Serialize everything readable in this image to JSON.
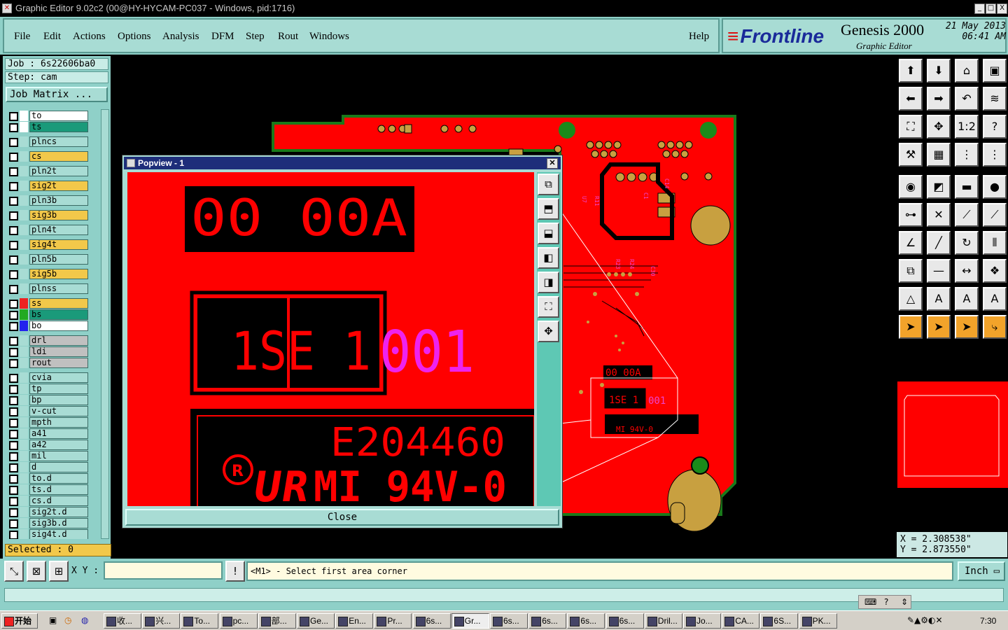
{
  "window": {
    "title": "Graphic Editor 9.02c2 (00@HY-HYCAM-PC037 - Windows, pid:1716)",
    "min": "_",
    "max": "□",
    "close": "X"
  },
  "menu": [
    "File",
    "Edit",
    "Actions",
    "Options",
    "Analysis",
    "DFM",
    "Step",
    "Rout",
    "Windows"
  ],
  "help": "Help",
  "brand": {
    "logo": "Frontline",
    "product": "Genesis 2000",
    "subtitle": "Graphic Editor",
    "date": "21 May 2013",
    "time": "06:41 AM"
  },
  "job": {
    "label": "Job : 6s22606ba0",
    "step": "Step: cam",
    "matrix_button": "Job Matrix ..."
  },
  "layers": [
    {
      "name": "to",
      "color": "#ffffff",
      "swatch": "#ffffff"
    },
    {
      "name": "ts",
      "color": "#1a9a7a",
      "swatch": "#ffffff"
    },
    {
      "name": "plncs",
      "color": "#a8dcd4",
      "swatch": "#a8dcd4"
    },
    {
      "name": "cs",
      "color": "#f2c84a",
      "swatch": "#a8dcd4"
    },
    {
      "name": "pln2t",
      "color": "#a8dcd4",
      "swatch": "#a8dcd4"
    },
    {
      "name": "sig2t",
      "color": "#f2c84a",
      "swatch": "#a8dcd4"
    },
    {
      "name": "pln3b",
      "color": "#a8dcd4",
      "swatch": "#a8dcd4"
    },
    {
      "name": "sig3b",
      "color": "#f2c84a",
      "swatch": "#a8dcd4"
    },
    {
      "name": "pln4t",
      "color": "#a8dcd4",
      "swatch": "#a8dcd4"
    },
    {
      "name": "sig4t",
      "color": "#f2c84a",
      "swatch": "#a8dcd4"
    },
    {
      "name": "pln5b",
      "color": "#a8dcd4",
      "swatch": "#a8dcd4"
    },
    {
      "name": "sig5b",
      "color": "#f2c84a",
      "swatch": "#a8dcd4"
    },
    {
      "name": "plnss",
      "color": "#a8dcd4",
      "swatch": "#a8dcd4"
    },
    {
      "name": "ss",
      "color": "#f2c84a",
      "swatch": "#ee2222"
    },
    {
      "name": "bs",
      "color": "#1a9a7a",
      "swatch": "#22aa22"
    },
    {
      "name": "bo",
      "color": "#ffffff",
      "swatch": "#2222ee"
    },
    {
      "name": "drl",
      "color": "#c0c0c0",
      "swatch": "#a8dcd4"
    },
    {
      "name": "ldi",
      "color": "#c0c0c0",
      "swatch": "#a8dcd4"
    },
    {
      "name": "rout",
      "color": "#c0c0c0",
      "swatch": "#a8dcd4"
    },
    {
      "name": "cvia",
      "color": "#a8dcd4",
      "swatch": "#a8dcd4"
    },
    {
      "name": "tp",
      "color": "#a8dcd4",
      "swatch": "#a8dcd4"
    },
    {
      "name": "bp",
      "color": "#a8dcd4",
      "swatch": "#a8dcd4"
    },
    {
      "name": "v-cut",
      "color": "#a8dcd4",
      "swatch": "#a8dcd4"
    },
    {
      "name": "mpth",
      "color": "#a8dcd4",
      "swatch": "#a8dcd4"
    },
    {
      "name": "a41",
      "color": "#a8dcd4",
      "swatch": "#a8dcd4"
    },
    {
      "name": "a42",
      "color": "#a8dcd4",
      "swatch": "#a8dcd4"
    },
    {
      "name": "mil",
      "color": "#a8dcd4",
      "swatch": "#a8dcd4"
    },
    {
      "name": "d",
      "color": "#a8dcd4",
      "swatch": "#a8dcd4"
    },
    {
      "name": "to.d",
      "color": "#a8dcd4",
      "swatch": "#a8dcd4"
    },
    {
      "name": "ts.d",
      "color": "#a8dcd4",
      "swatch": "#a8dcd4"
    },
    {
      "name": "cs.d",
      "color": "#a8dcd4",
      "swatch": "#a8dcd4"
    },
    {
      "name": "sig2t.d",
      "color": "#a8dcd4",
      "swatch": "#a8dcd4"
    },
    {
      "name": "sig3b.d",
      "color": "#a8dcd4",
      "swatch": "#a8dcd4"
    },
    {
      "name": "sig4t.d",
      "color": "#a8dcd4",
      "swatch": "#a8dcd4"
    }
  ],
  "selected": "Selected : 0",
  "popview": {
    "title": "Popview - 1",
    "close_label": "Close",
    "marking_top": "00 00A",
    "marking_code": "1SE 1",
    "marking_pink": "001",
    "marking_ul": "E204460",
    "marking_rating": "MI 94V-0"
  },
  "coords": {
    "x": "X = 2.308538\"",
    "y": "Y = 2.873550\""
  },
  "status": {
    "xy_label": "X Y :",
    "xy_value": "",
    "prompt": "<M1> - Select first area corner",
    "units": "Inch"
  },
  "taskbar": {
    "start": "开始",
    "tasks": [
      "收...",
      "兴...",
      "To...",
      "pc...",
      "部...",
      "Ge...",
      "En...",
      "Pr...",
      "6s...",
      "Gr...",
      "6s...",
      "6s...",
      "6s...",
      "6s...",
      "Dril...",
      "Jo...",
      "CA...",
      "6S...",
      "PK..."
    ],
    "clock": "7:30"
  },
  "colors": {
    "panel": "#8fd0c8",
    "pcb_red": "#ff0000",
    "board_green": "#1a7a1a",
    "pad_gold": "#c8a040",
    "title_navy": "#1e2e7a"
  }
}
